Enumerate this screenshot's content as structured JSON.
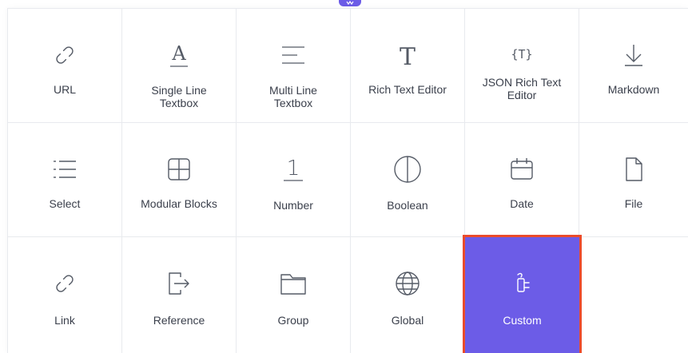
{
  "accent_color": "#6c5ce7",
  "highlight_border_color": "#ea4b2b",
  "fields": [
    {
      "label": "URL",
      "icon": "url-link-icon"
    },
    {
      "label": "Single Line Textbox",
      "icon": "single-line-text-icon"
    },
    {
      "label": "Multi Line Textbox",
      "icon": "multi-line-text-icon"
    },
    {
      "label": "Rich Text Editor",
      "icon": "rich-text-icon"
    },
    {
      "label": "JSON Rich Text Editor",
      "icon": "json-rich-text-icon"
    },
    {
      "label": "Markdown",
      "icon": "markdown-arrow-icon"
    },
    {
      "label": "Select",
      "icon": "list-select-icon"
    },
    {
      "label": "Modular Blocks",
      "icon": "modular-blocks-icon"
    },
    {
      "label": "Number",
      "icon": "number-one-icon"
    },
    {
      "label": "Boolean",
      "icon": "boolean-circle-icon"
    },
    {
      "label": "Date",
      "icon": "calendar-icon"
    },
    {
      "label": "File",
      "icon": "file-icon"
    },
    {
      "label": "Link",
      "icon": "link-icon"
    },
    {
      "label": "Reference",
      "icon": "reference-icon"
    },
    {
      "label": "Group",
      "icon": "folder-icon"
    },
    {
      "label": "Global",
      "icon": "globe-icon"
    },
    {
      "label": "Custom",
      "icon": "plug-icon",
      "selected": true
    }
  ],
  "field_labels": {
    "url": "URL",
    "single_line_1": "Single Line",
    "single_line_2": "Textbox",
    "multi_line_1": "Multi Line",
    "multi_line_2": "Textbox",
    "rich_text": "Rich Text Editor",
    "json_rich_1": "JSON Rich Text",
    "json_rich_2": "Editor",
    "markdown": "Markdown",
    "select": "Select",
    "modular_blocks": "Modular Blocks",
    "number": "Number",
    "boolean": "Boolean",
    "date": "Date",
    "file": "File",
    "link": "Link",
    "reference": "Reference",
    "group": "Group",
    "global": "Global",
    "custom": "Custom"
  },
  "icon_glyphs": {
    "single_line": "A",
    "rich_text": "T",
    "json_rich": "{T}",
    "number": "1"
  }
}
